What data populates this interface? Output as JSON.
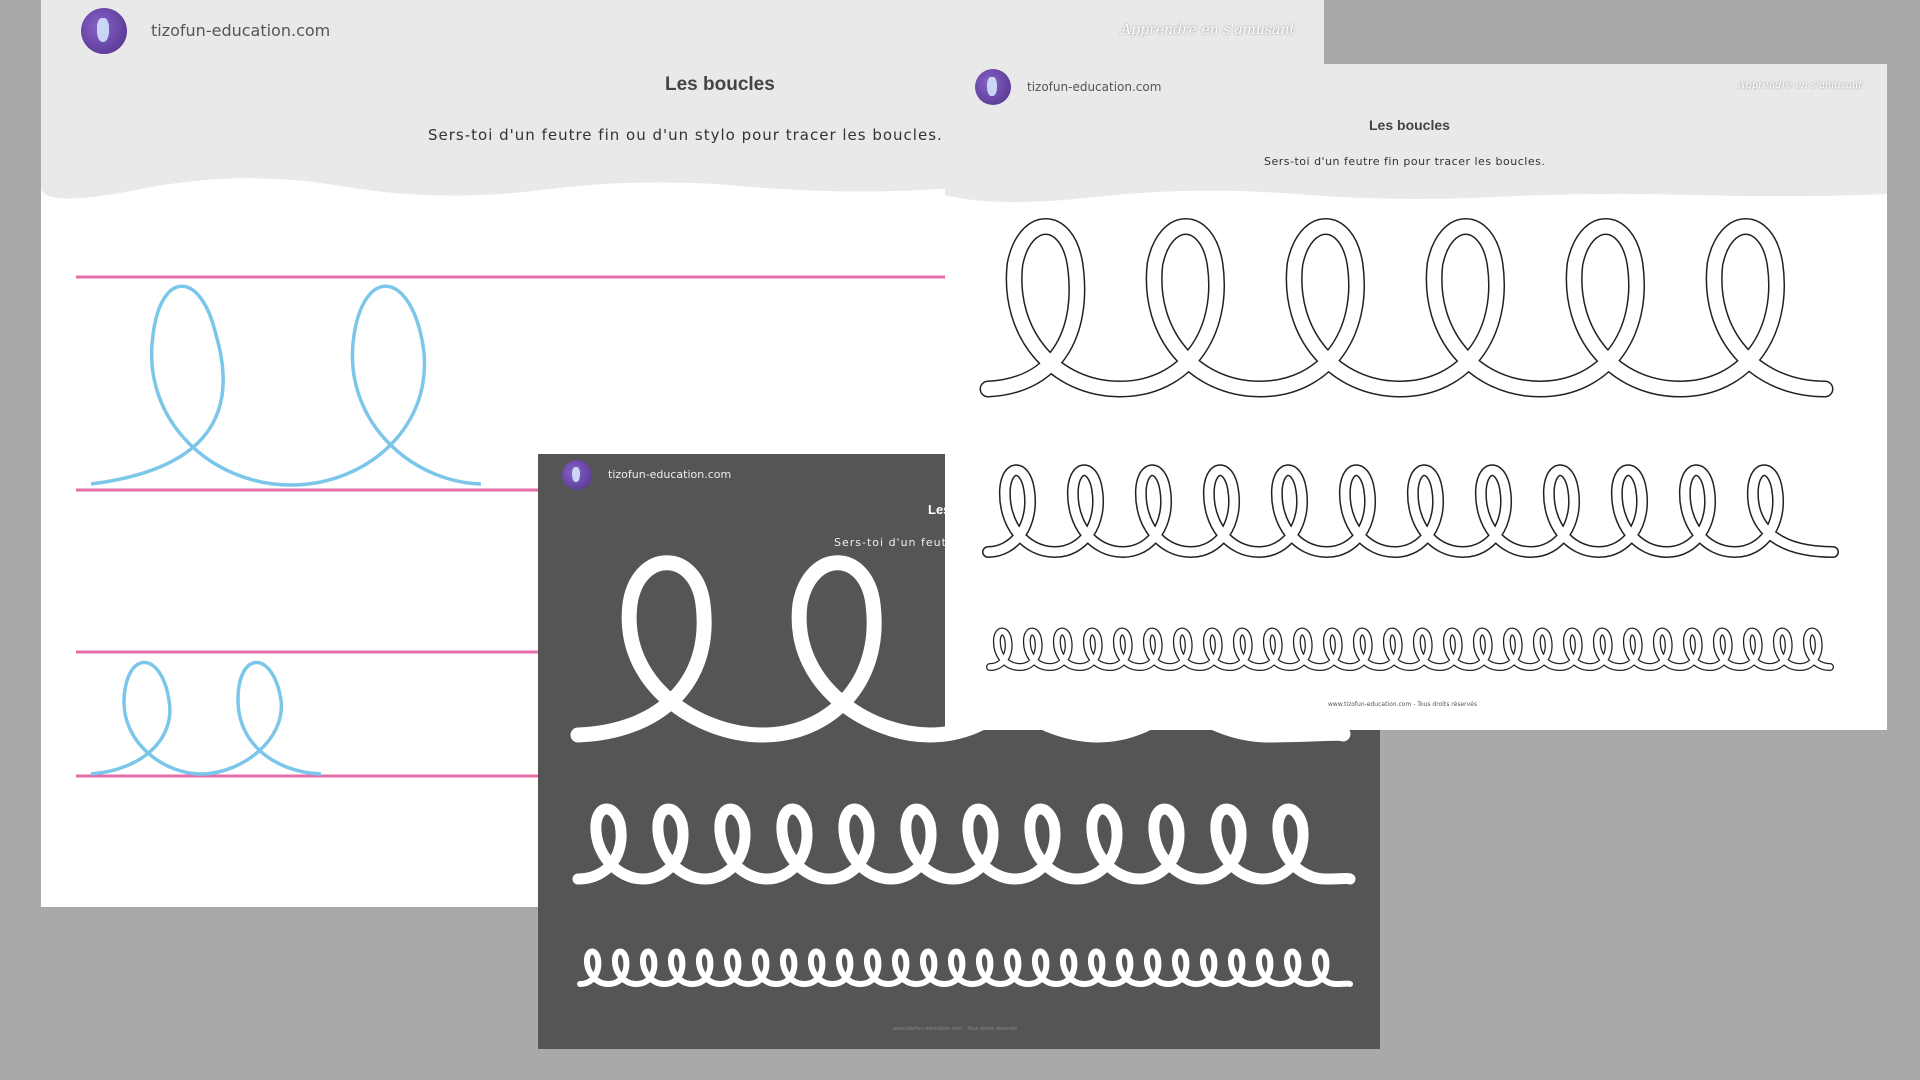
{
  "colors": {
    "background": "#a9a9aa",
    "header_gray": "#e9e9ea",
    "pink_line": "#e56ea8",
    "blue_loop": "#7cc6ea",
    "dark_sheet": "#555555"
  },
  "sheet_left": {
    "site": "tizofun-education.com",
    "tagline": "Apprendre en s'amusant",
    "title": "Les boucles",
    "instruction": "Sers-toi d'un feutre fin ou d'un stylo pour tracer les boucles.",
    "logo_icon": "bunny-logo-icon"
  },
  "sheet_right": {
    "site": "tizofun-education.com",
    "tagline": "Apprendre en s'amusant",
    "title": "Les boucles",
    "instruction": "Sers-toi d'un feutre fin pour tracer les boucles.",
    "footer": "www.tizofun-education.com - Tous droits réservés",
    "logo_icon": "bunny-logo-icon"
  },
  "sheet_dark": {
    "site": "tizofun-education.com",
    "title": "Les",
    "instruction": "Sers-toi d'un feutre",
    "footer": "www.tizofun-education.com - Tous droits réservés",
    "logo_icon": "bunny-logo-icon"
  }
}
